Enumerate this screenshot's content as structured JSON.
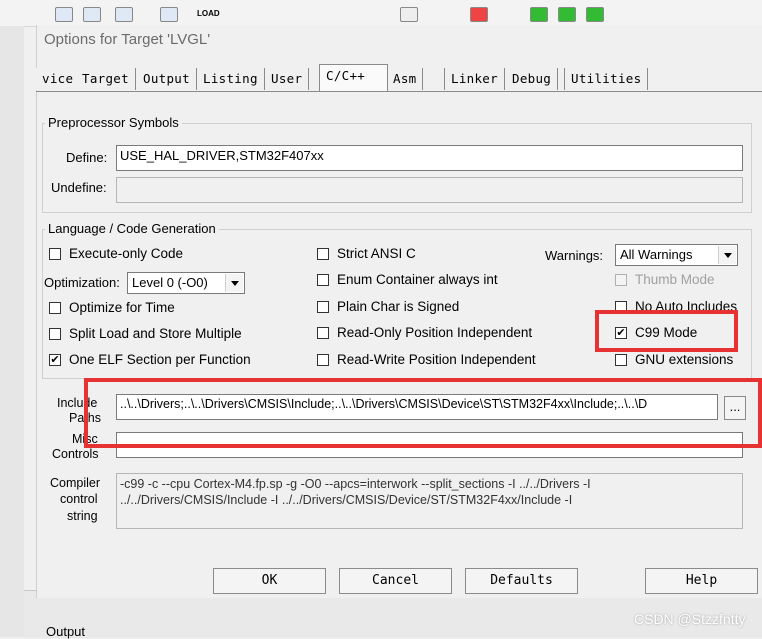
{
  "ide": {
    "toolbar_text": "LVGL",
    "load_icon_text": "LOAD",
    "output_label": "Output"
  },
  "dialog": {
    "title": "Options for Target 'LVGL'",
    "tabs": [
      "vice",
      "Target",
      "Output",
      "Listing",
      "User",
      "C/C++",
      "Asm",
      "Linker",
      "Debug",
      "Utilities"
    ],
    "active_tab": "C/C++"
  },
  "preprocessor": {
    "group_title": "Preprocessor Symbols",
    "define_label": "Define:",
    "define_value": "USE_HAL_DRIVER,STM32F407xx",
    "undefine_label": "Undefine:",
    "undefine_value": ""
  },
  "language": {
    "group_title": "Language / Code Generation",
    "execute_only": {
      "label": "Execute-only Code",
      "checked": false
    },
    "optimization_label": "Optimization:",
    "optimization_value": "Level 0 (-O0)",
    "optimize_time": {
      "label": "Optimize for Time",
      "checked": false
    },
    "split_load": {
      "label": "Split Load and Store Multiple",
      "checked": false
    },
    "one_elf": {
      "label": "One ELF Section per Function",
      "checked": true
    },
    "strict_ansi": {
      "label": "Strict ANSI C",
      "checked": false
    },
    "enum_container": {
      "label": "Enum Container always int",
      "checked": false
    },
    "plain_char": {
      "label": "Plain Char is Signed",
      "checked": false
    },
    "ro_pi": {
      "label": "Read-Only Position Independent",
      "checked": false
    },
    "rw_pi": {
      "label": "Read-Write Position Independent",
      "checked": false
    },
    "warnings_label": "Warnings:",
    "warnings_value": "All Warnings",
    "thumb_mode": {
      "label": "Thumb Mode",
      "checked": false
    },
    "no_auto_includes": {
      "label": "No Auto Includes",
      "checked": false
    },
    "c99_mode": {
      "label": "C99 Mode",
      "checked": true
    },
    "gnu_ext": {
      "label": "GNU extensions",
      "checked": false
    }
  },
  "paths": {
    "include_label_line1": "Include",
    "include_label_line2": "Paths",
    "include_value": "..\\..\\Drivers;..\\..\\Drivers\\CMSIS\\Include;..\\..\\Drivers\\CMSIS\\Device\\ST\\STM32F4xx\\Include;..\\..\\D",
    "browse_label": "...",
    "misc_label_line1": "Misc",
    "misc_label_line2": "Controls",
    "misc_value": "",
    "compiler_label_line1": "Compiler",
    "compiler_label_line2": "control",
    "compiler_label_line3": "string",
    "compiler_value": "-c99 -c --cpu Cortex-M4.fp.sp -g -O0 --apcs=interwork --split_sections -I ../../Drivers -I ../../Drivers/CMSIS/Include -I ../../Drivers/CMSIS/Device/ST/STM32F4xx/Include -I"
  },
  "buttons": {
    "ok": "OK",
    "cancel": "Cancel",
    "defaults": "Defaults",
    "help": "Help"
  },
  "watermark": "CSDN @Stzzfntty",
  "colors": {
    "highlight": "#e63232",
    "dialog_bg": "#f0f0f0"
  }
}
